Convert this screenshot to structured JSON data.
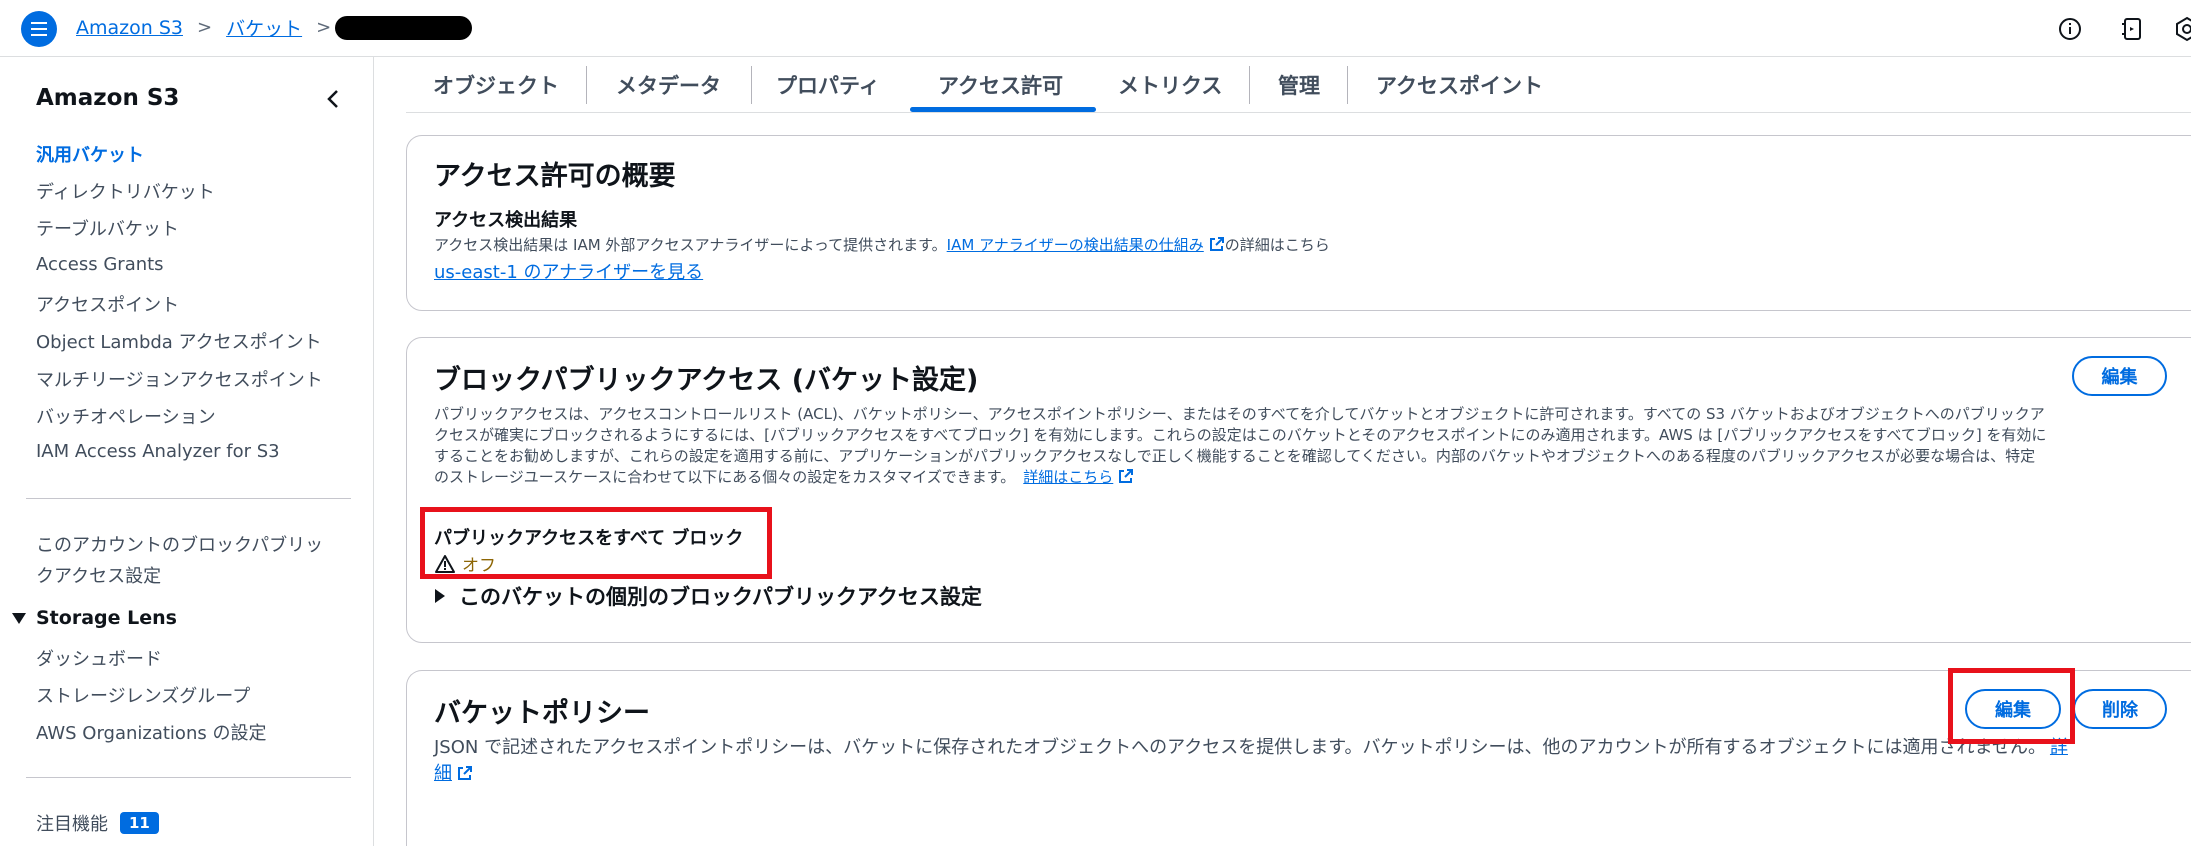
{
  "breadcrumb": {
    "service": "Amazon S3",
    "section": "バケット"
  },
  "sidebar": {
    "title": "Amazon S3",
    "items": [
      {
        "label": "汎用バケット",
        "active": true
      },
      {
        "label": "ディレクトリバケット"
      },
      {
        "label": "テーブルバケット"
      },
      {
        "label": "Access Grants"
      },
      {
        "label": "アクセスポイント"
      },
      {
        "label": "Object Lambda アクセスポイント"
      },
      {
        "label": "マルチリージョンアクセスポイント"
      },
      {
        "label": "バッチオペレーション"
      },
      {
        "label": "IAM Access Analyzer for S3"
      }
    ],
    "block_setting": {
      "line1": "このアカウントのブロックパブリッ",
      "line2": "クアクセス設定"
    },
    "storage_lens": {
      "label": "Storage Lens",
      "items": [
        "ダッシュボード",
        "ストレージレンズグループ",
        "AWS Organizations の設定"
      ]
    },
    "featured": {
      "label": "注目機能",
      "count": "11"
    }
  },
  "tabs": [
    {
      "label": "オブジェクト"
    },
    {
      "label": "メタデータ"
    },
    {
      "label": "プロパティ"
    },
    {
      "label": "アクセス許可",
      "active": true
    },
    {
      "label": "メトリクス"
    },
    {
      "label": "管理"
    },
    {
      "label": "アクセスポイント"
    }
  ],
  "overview": {
    "title": "アクセス許可の概要",
    "findings_title": "アクセス検出結果",
    "findings_desc": "アクセス検出結果は IAM 外部アクセスアナライザーによって提供されます。",
    "findings_link": "IAM アナライザーの検出結果の仕組み",
    "findings_suffix": "の詳細はこちら",
    "analyzer_link": "us-east-1 のアナライザーを見る"
  },
  "block_public": {
    "title": "ブロックパブリックアクセス (バケット設定)",
    "edit_label": "編集",
    "desc_line1": "パブリックアクセスは、アクセスコントロールリスト (ACL)、バケットポリシー、アクセスポイントポリシー、またはそのすべてを介してバケットとオブジェクトに許可されます。すべての S3 バケットおよびオブジェクトへのパブリックア",
    "desc_line2": "クセスが確実にブロックされるようにするには、[パブリックアクセスをすべてブロック] を有効にします。これらの設定はこのバケットとそのアクセスポイントにのみ適用されます。AWS は [パブリックアクセスをすべてブロック] を有効に",
    "desc_line3": "することをお勧めしますが、これらの設定を適用する前に、アプリケーションがパブリックアクセスなしで正しく機能することを確認してください。内部のバケットやオブジェクトへのある程度のパブリックアクセスが必要な場合は、特定",
    "desc_line4": "のストレージユースケースに合わせて以下にある個々の設定をカスタマイズできます。",
    "learn_more": "詳細はこちら",
    "block_all_label": "パブリックアクセスをすべて ブロック",
    "block_all_status": "オフ",
    "expander_label": "このバケットの個別のブロックパブリックアクセス設定",
    "warning_color": "#8d6605"
  },
  "bucket_policy": {
    "title": "バケットポリシー",
    "edit_label": "編集",
    "delete_label": "削除",
    "desc": "JSON で記述されたアクセスポイントポリシーは、バケットに保存されたオブジェクトへのアクセスを提供します。バケットポリシーは、他のアカウントが所有するオブジェクトには適用されません。",
    "link_part1": "詳",
    "link_part2": "細"
  },
  "colors": {
    "accent": "#006ce0",
    "highlight": "#e8111b"
  }
}
